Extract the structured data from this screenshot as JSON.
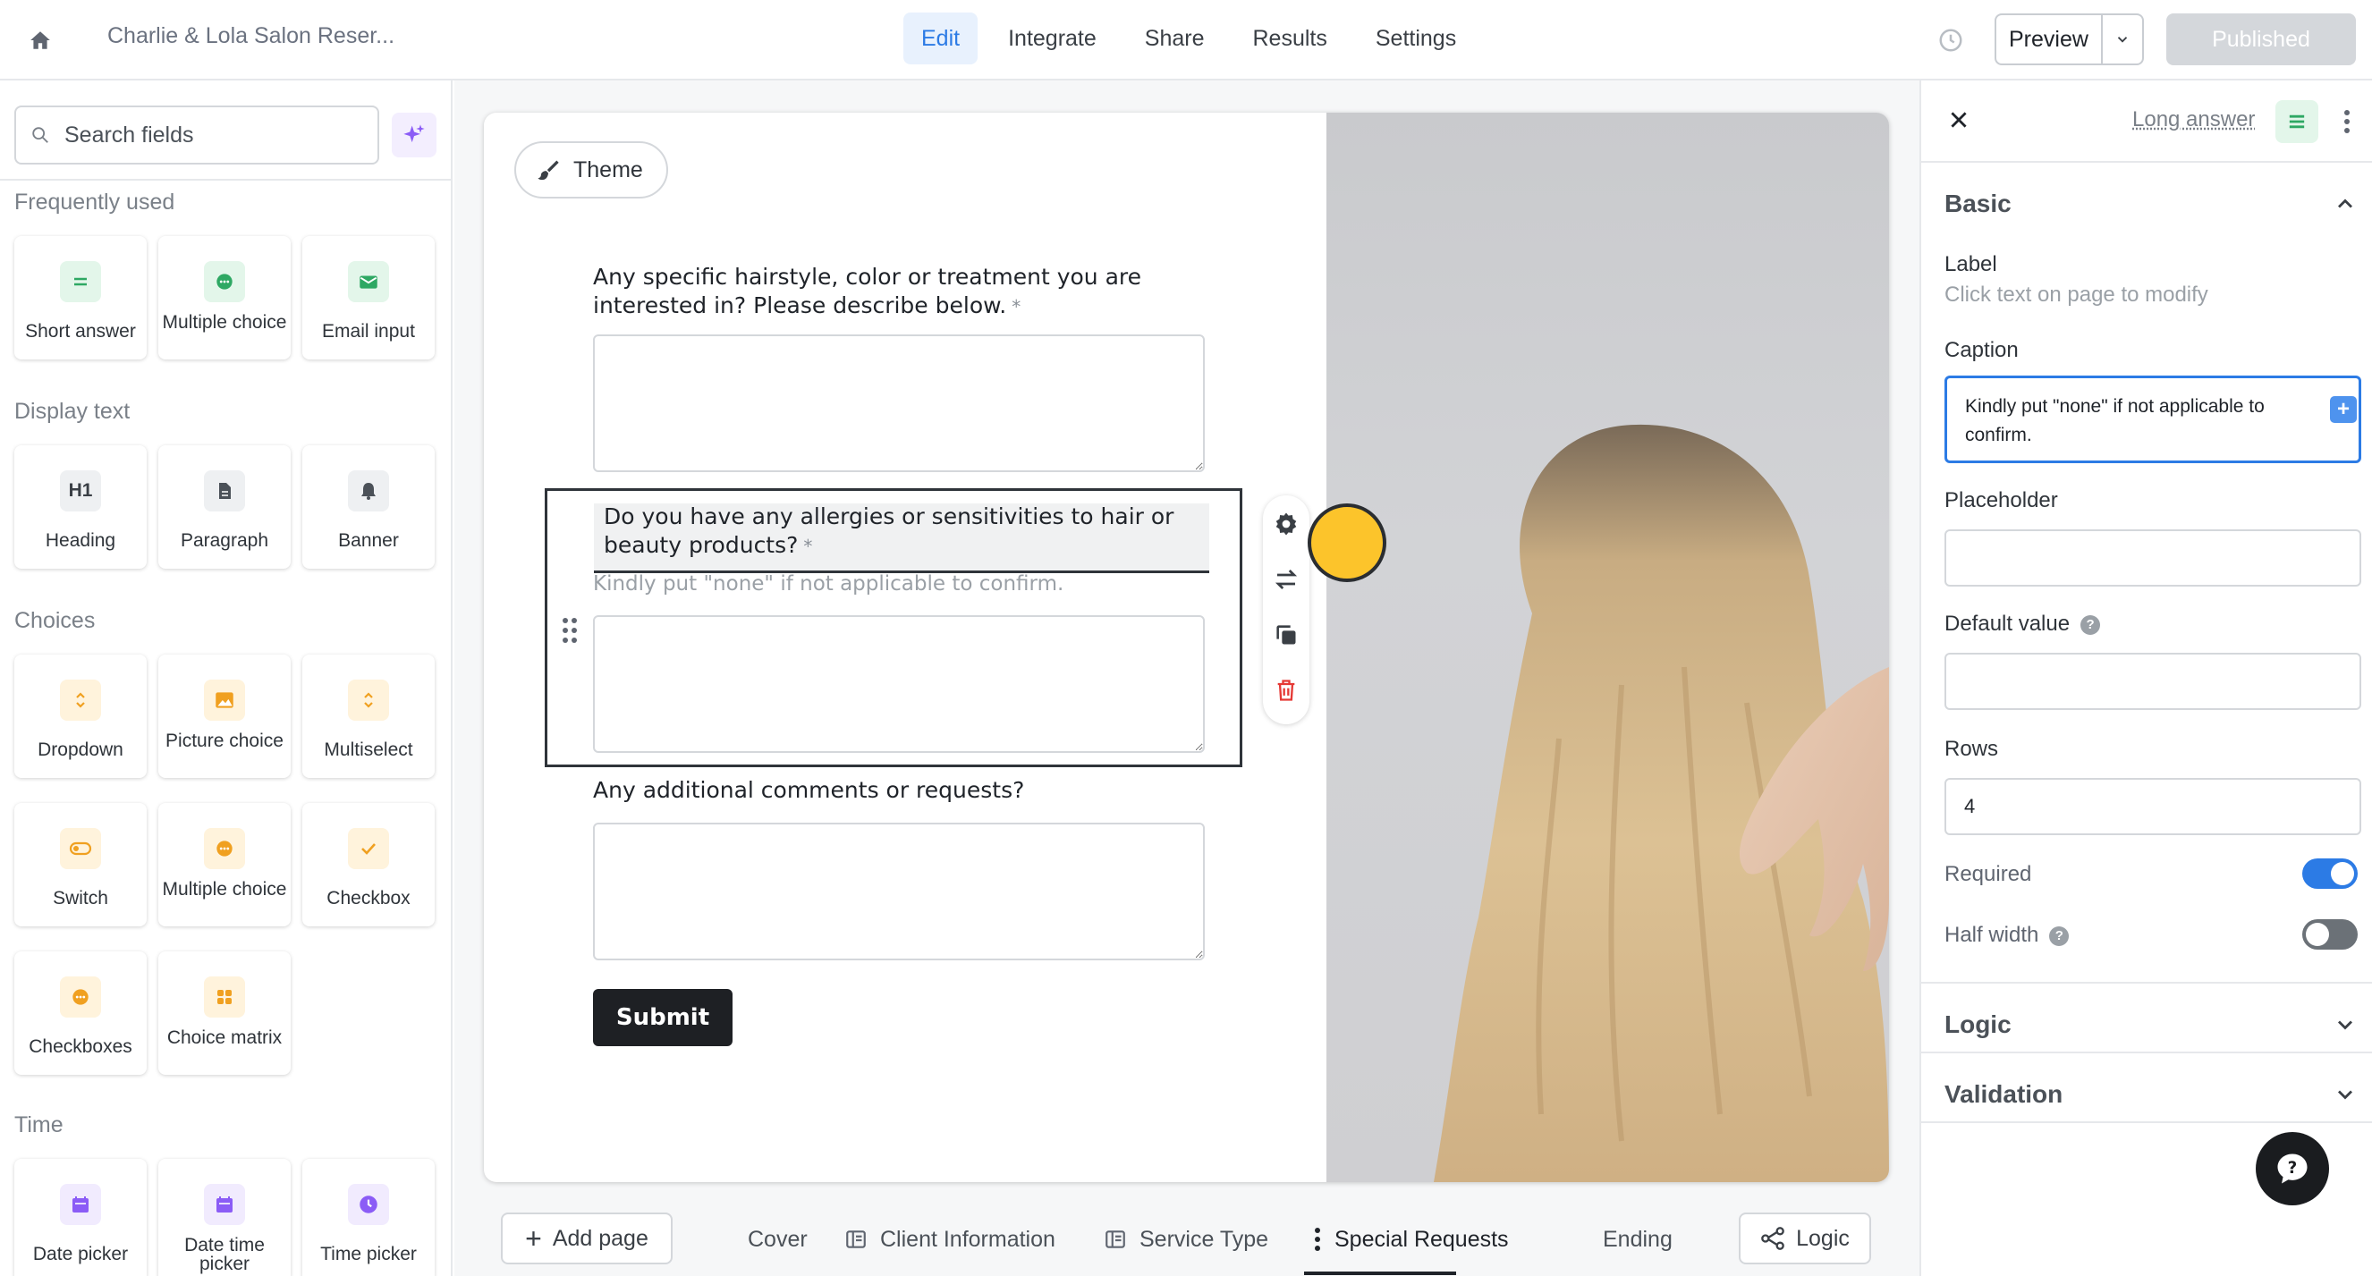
{
  "topbar": {
    "app_title": "Charlie & Lola Salon Reser...",
    "tabs": [
      {
        "label": "Edit",
        "active": true
      },
      {
        "label": "Integrate",
        "active": false
      },
      {
        "label": "Share",
        "active": false
      },
      {
        "label": "Results",
        "active": false
      },
      {
        "label": "Settings",
        "active": false
      }
    ],
    "preview_label": "Preview",
    "published_label": "Published"
  },
  "left_sidebar": {
    "search_placeholder": "Search fields",
    "sections": {
      "frequently_used": "Frequently used",
      "display_text": "Display text",
      "choices": "Choices",
      "time": "Time"
    },
    "fields": {
      "short_answer": "Short answer",
      "multiple_choice": "Multiple choice",
      "email_input": "Email input",
      "heading": "Heading",
      "heading_icon_text": "H1",
      "paragraph": "Paragraph",
      "banner": "Banner",
      "dropdown": "Dropdown",
      "picture_choice": "Picture choice",
      "multiselect": "Multiselect",
      "switch": "Switch",
      "multiple_choice_2": "Multiple choice",
      "checkbox": "Checkbox",
      "checkboxes": "Checkboxes",
      "choice_matrix": "Choice matrix",
      "date_picker": "Date picker",
      "date_time_picker": "Date time picker",
      "time_picker": "Time picker"
    }
  },
  "form": {
    "theme_label": "Theme",
    "questions": [
      {
        "label": "Any specific hairstyle, color or treatment you are interested in? Please describe below.",
        "required_mark": "*"
      },
      {
        "label": "Do you have any allergies or sensitivities to hair or beauty products?",
        "required_mark": "*",
        "caption": "Kindly put \"none\" if not applicable to confirm."
      },
      {
        "label": "Any additional comments or requests?"
      }
    ],
    "submit_label": "Submit"
  },
  "page_bar": {
    "add_page_label": "Add page",
    "pages": [
      {
        "label": "Cover"
      },
      {
        "label": "Client Information"
      },
      {
        "label": "Service Type"
      },
      {
        "label": "Special Requests",
        "active": true
      },
      {
        "label": "Ending"
      }
    ],
    "logic_label": "Logic"
  },
  "right_panel": {
    "field_type": "Long answer",
    "basic_title": "Basic",
    "label_title": "Label",
    "label_hint": "Click text on page to modify",
    "caption_title": "Caption",
    "caption_value": "Kindly put \"none\" if not applicable to confirm.",
    "placeholder_title": "Placeholder",
    "placeholder_value": "",
    "default_value_title": "Default value",
    "default_value": "",
    "rows_title": "Rows",
    "rows_value": "4",
    "required_title": "Required",
    "required_on": true,
    "half_width_title": "Half width",
    "half_width_on": false,
    "logic_title": "Logic",
    "validation_title": "Validation"
  },
  "colors": {
    "accent": "#2c7be5",
    "cursor_highlight": "#fcc42b",
    "delete_red": "#e53935"
  }
}
